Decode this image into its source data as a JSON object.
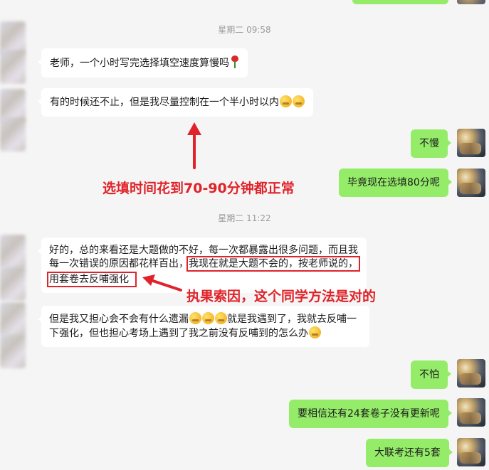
{
  "timestamps": [
    "星期二 09:58",
    "星期二 11:22"
  ],
  "messages": {
    "m1": "老师，一个小时写完选择填空速度算慢吗",
    "m2": "有的时候还不止，但是我尽量控制在一个半小时以内",
    "m3": "不慢",
    "m4": "毕竟现在选填80分呢",
    "m5_line1_a": "好的，总的来看还是大题做的不好，每一次都暴露出很多问题，而且我",
    "m5_line2_a": "每一次错误的原因都花样百出，",
    "m5_line2_b": "我现在就是大题不会的，按老师说的，",
    "m5_line3_b": "用套卷去反哺强化",
    "m6_line1_a": "但是我又担心会不会有什么遗漏",
    "m6_line1_b": "就是我遇到了，我就去反哺一",
    "m6_line2": "下强化，但也担心考场上遇到了我之前没有反哺到的怎么办",
    "m7": "不怕",
    "m8": "要相信还有24套卷子没有更新呢",
    "m9": "大联考还有5套"
  },
  "annotations": {
    "a1": "选填时间花到70-90分钟都正常",
    "a2": "执果索因，这个同学方法是对的"
  },
  "colors": {
    "accent": "#e0232a",
    "right_bubble": "#95ec69",
    "left_bubble": "#ffffff"
  }
}
